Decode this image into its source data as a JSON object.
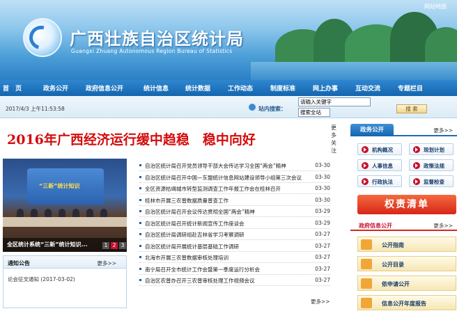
{
  "header": {
    "title": "广西壮族自治区统计局",
    "subtitle": "Guangxi Zhuang Autonomous Region Bureau of Statistics",
    "top_link": "网站地图"
  },
  "nav": {
    "items": [
      "首　页",
      "政务公开",
      "政府信息公开",
      "统计信息",
      "统计数据",
      "工作动态",
      "制度标准",
      "网上办事",
      "互动交流",
      "专题栏目"
    ]
  },
  "infobar": {
    "datetime": "2017/4/3 上午11:53:58",
    "search_label": "站内搜索：",
    "search_value": "请输入关键字",
    "search_scope": "搜索全站",
    "search_button": "搜 索"
  },
  "banner": {
    "headline": "2016年广西经济运行缓中趋稳　稳中向好",
    "more_vertical": "更多关注"
  },
  "slideshow": {
    "caption": "全区统计系统“三新”统计知识...",
    "stage_text": "“三新”统计知识",
    "pages": [
      "1",
      "2",
      "3"
    ],
    "active_page": 2
  },
  "news": {
    "items": [
      {
        "title": "自治区统计局召开党员领导干部大会传达学习全国“两会”精神",
        "date": "03-30"
      },
      {
        "title": "自治区统计局召开中国—东盟统计信息网站建设领导小组第三次会议",
        "date": "03-30"
      },
      {
        "title": "全区资源枯竭城市转型监测调查工作年报工作会在桂林召开",
        "date": "03-30"
      },
      {
        "title": "桂林市开展三农普数据质量普查工作",
        "date": "03-30"
      },
      {
        "title": "自治区统计局召开会议传达贯彻全国“两会”精神",
        "date": "03-29"
      },
      {
        "title": "自治区统计局召开统计新闻宣传工作座谈会",
        "date": "03-29"
      },
      {
        "title": "自治区统计局调研组赴吉林省学习考察调研",
        "date": "03-27"
      },
      {
        "title": "自治区统计局开展统计基层基础工作调研",
        "date": "03-27"
      },
      {
        "title": "北海市开展三农普数据审核处理培训",
        "date": "03-27"
      },
      {
        "title": "南宁局召开全市统计工作会暨第一季度运行分析会",
        "date": "03-27"
      },
      {
        "title": "自治区农普办召开三农普审核处理工作视频会议",
        "date": "03-27"
      }
    ],
    "more": "更多>>"
  },
  "notice": {
    "title": "通知公告",
    "more": "更多>>",
    "items": [
      {
        "title": "论会征文通知 (2017-03-02)"
      }
    ]
  },
  "right": {
    "tab": "政务公开",
    "more": "更多>>",
    "buttons": [
      "机构概况",
      "现划计划",
      "人事信息",
      "政策法规",
      "行政执法",
      "监督检查"
    ],
    "qingdan": "权责清单",
    "pub_title": "政府信息公开",
    "pub_more": "更多>>",
    "pub_items": [
      "公开指南",
      "公开目录",
      "依申请公开",
      "信息公开年度报告"
    ]
  }
}
